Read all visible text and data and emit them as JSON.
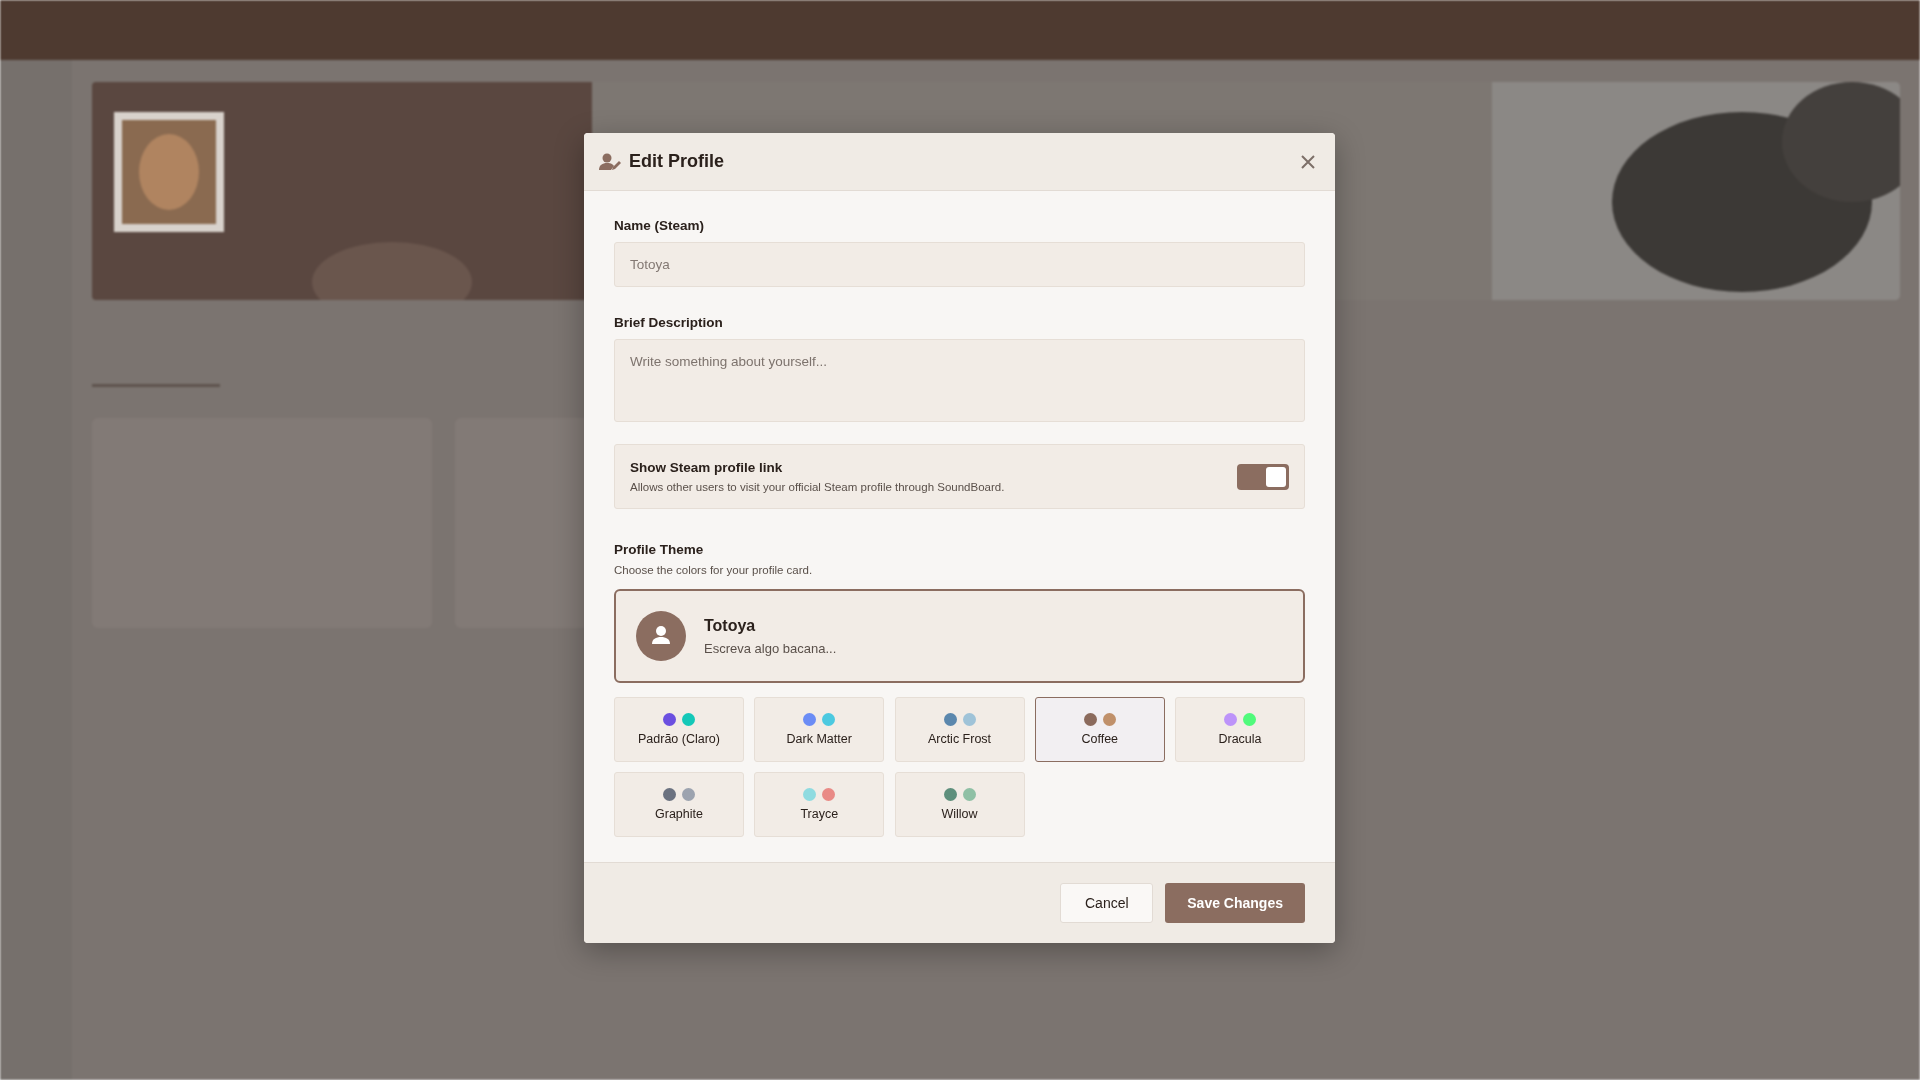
{
  "dialog": {
    "title": "Edit Profile",
    "name_field": {
      "label": "Name (Steam)",
      "value": "Totoya",
      "disabled": true
    },
    "description_field": {
      "label": "Brief Description",
      "placeholder": "Write something about yourself..."
    },
    "steam_link": {
      "title": "Show Steam profile link",
      "description": "Allows other users to visit your official Steam profile through SoundBoard.",
      "on": true
    },
    "theme": {
      "title": "Profile Theme",
      "subtitle": "Choose the colors for your profile card.",
      "preview": {
        "name": "Totoya",
        "bio": "Escreva algo bacana..."
      },
      "options": [
        {
          "label": "Padrão (Claro)",
          "dots": [
            {
              "color": "#6b4fe0"
            },
            {
              "color": "#14c8b8"
            }
          ],
          "selected": false
        },
        {
          "label": "Dark Matter",
          "dots": [
            {
              "color": "#6b8cf5"
            },
            {
              "color": "#4cc9e0"
            }
          ],
          "selected": false
        },
        {
          "label": "Arctic Frost",
          "dots": [
            {
              "color": "#5b87ad"
            },
            {
              "color": "#9fc3d8"
            }
          ],
          "selected": false
        },
        {
          "label": "Coffee",
          "dots": [
            {
              "color": "#8b6a5c"
            },
            {
              "color": "#c0906a"
            }
          ],
          "selected": true
        },
        {
          "label": "Dracula",
          "dots": [
            {
              "color": "#bd93f9"
            },
            {
              "color": "#50fa7b"
            }
          ],
          "selected": false
        },
        {
          "label": "Graphite",
          "dots": [
            {
              "color": "#6b7280"
            },
            {
              "color": "#9ca3af"
            }
          ],
          "selected": false
        },
        {
          "label": "Trayce",
          "dots": [
            {
              "color": "#8fdbe0"
            },
            {
              "color": "#e98a86"
            }
          ],
          "selected": false
        },
        {
          "label": "Willow",
          "dots": [
            {
              "color": "#5e8f7c"
            },
            {
              "color": "#8fc0a5"
            }
          ],
          "selected": false
        }
      ]
    },
    "buttons": [
      {
        "label": "Cancel",
        "kind": "secondary"
      },
      {
        "label": "Save Changes",
        "kind": "primary"
      }
    ]
  }
}
